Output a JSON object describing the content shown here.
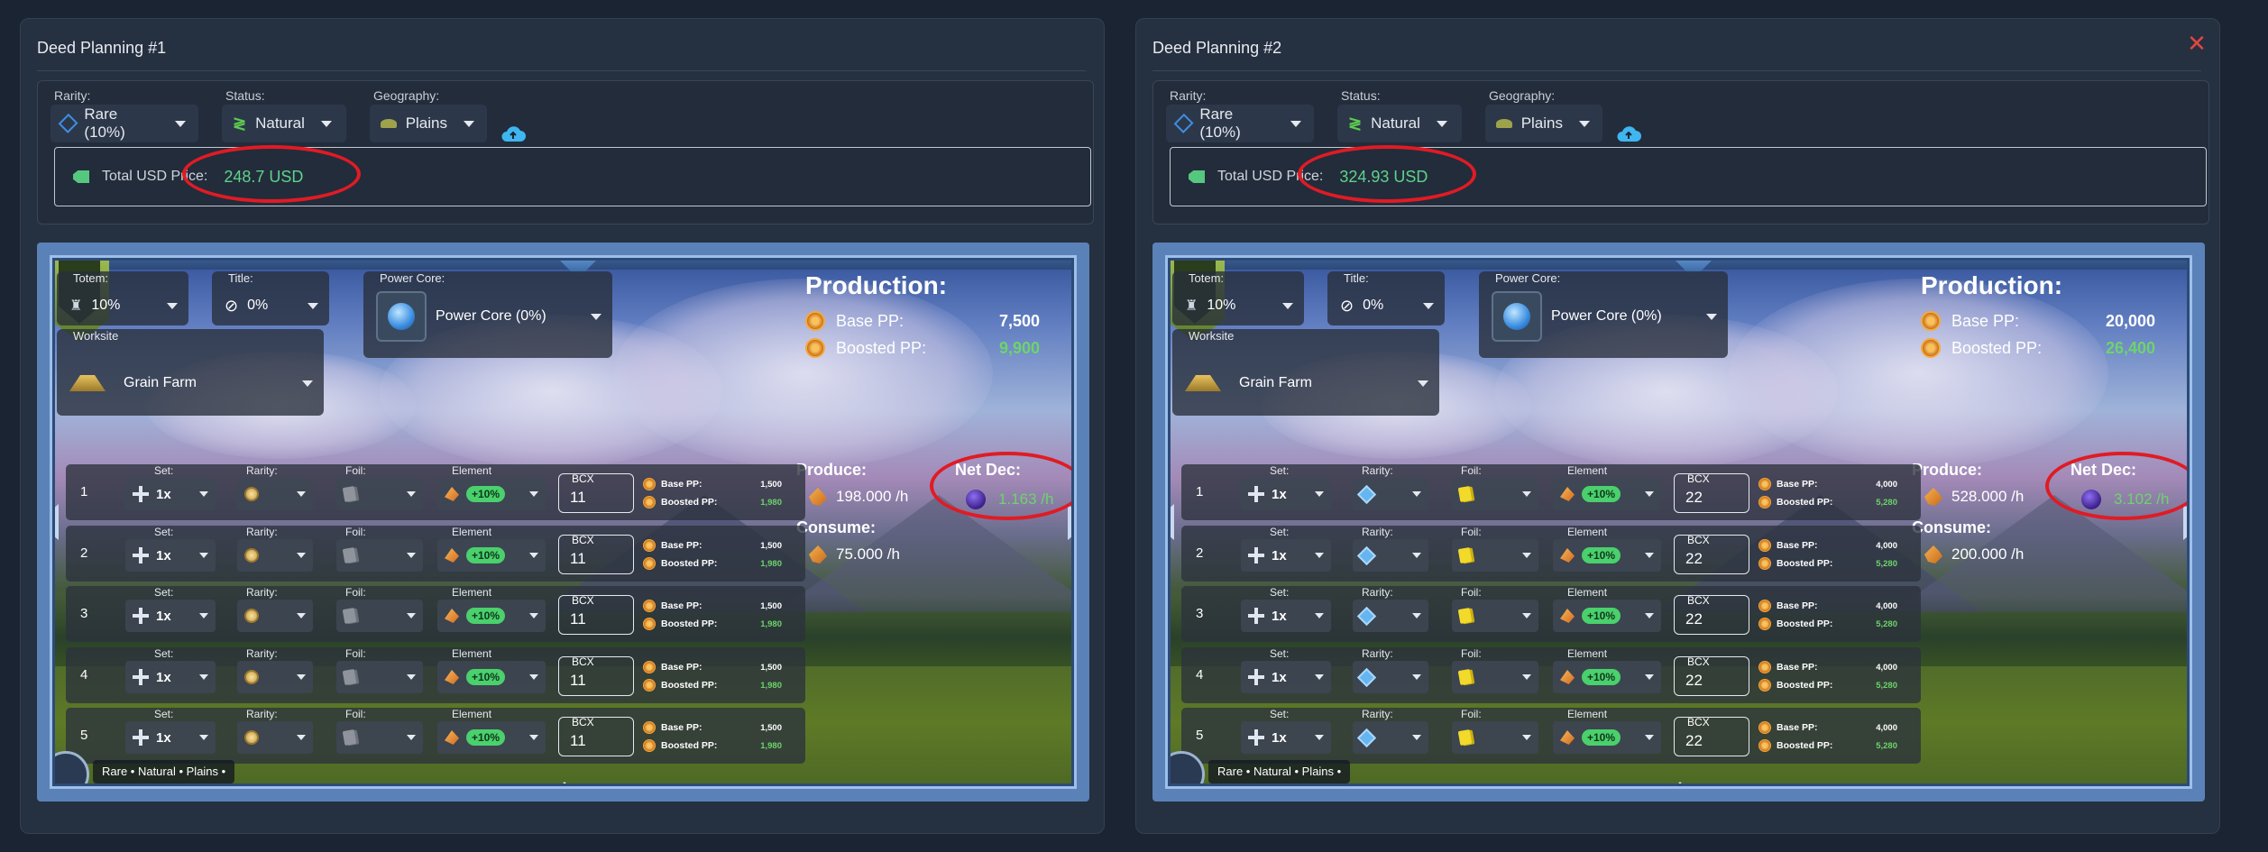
{
  "panels": [
    {
      "title": "Deed Planning #1",
      "rarity": {
        "label": "Rarity:",
        "value": "Rare (10%)"
      },
      "status": {
        "label": "Status:",
        "value": "Natural"
      },
      "geography": {
        "label": "Geography:",
        "value": "Plains"
      },
      "price_label": "Total USD Price:",
      "price_value": "248.7 USD",
      "totem": {
        "label": "Totem:",
        "value": "10%"
      },
      "title_ctl": {
        "label": "Title:",
        "value": "0%"
      },
      "power_core": {
        "label": "Power Core:",
        "value": "Power Core (0%)"
      },
      "worksite": {
        "label": "Worksite",
        "value": "Grain Farm"
      },
      "production": {
        "title": "Production:",
        "base_label": "Base PP:",
        "base_value": "7,500",
        "boosted_label": "Boosted PP:",
        "boosted_value": "9,900"
      },
      "produce": {
        "title": "Produce:",
        "value": "198.000 /h"
      },
      "consume": {
        "title": "Consume:",
        "value": "75.000 /h"
      },
      "net_dec": {
        "title": "Net Dec:",
        "value": "1.163 /h"
      },
      "footer": "Rare • Natural • Plains •",
      "cards": [
        {
          "num": "1",
          "set": "1x",
          "rarity_icon": "gold-rarity-icon",
          "foil_icon": "grey-foil-icon",
          "bonus": "+10%",
          "bcx": "11",
          "base_pp": "1,500",
          "boosted_pp": "1,980"
        },
        {
          "num": "2",
          "set": "1x",
          "rarity_icon": "gold-rarity-icon",
          "foil_icon": "grey-foil-icon",
          "bonus": "+10%",
          "bcx": "11",
          "base_pp": "1,500",
          "boosted_pp": "1,980"
        },
        {
          "num": "3",
          "set": "1x",
          "rarity_icon": "gold-rarity-icon",
          "foil_icon": "grey-foil-icon",
          "bonus": "+10%",
          "bcx": "11",
          "base_pp": "1,500",
          "boosted_pp": "1,980"
        },
        {
          "num": "4",
          "set": "1x",
          "rarity_icon": "gold-rarity-icon",
          "foil_icon": "grey-foil-icon",
          "bonus": "+10%",
          "bcx": "11",
          "base_pp": "1,500",
          "boosted_pp": "1,980"
        },
        {
          "num": "5",
          "set": "1x",
          "rarity_icon": "gold-rarity-icon",
          "foil_icon": "grey-foil-icon",
          "bonus": "+10%",
          "bcx": "11",
          "base_pp": "1,500",
          "boosted_pp": "1,980"
        }
      ]
    },
    {
      "title": "Deed Planning #2",
      "rarity": {
        "label": "Rarity:",
        "value": "Rare (10%)"
      },
      "status": {
        "label": "Status:",
        "value": "Natural"
      },
      "geography": {
        "label": "Geography:",
        "value": "Plains"
      },
      "price_label": "Total USD Price:",
      "price_value": "324.93 USD",
      "totem": {
        "label": "Totem:",
        "value": "10%"
      },
      "title_ctl": {
        "label": "Title:",
        "value": "0%"
      },
      "power_core": {
        "label": "Power Core:",
        "value": "Power Core (0%)"
      },
      "worksite": {
        "label": "Worksite",
        "value": "Grain Farm"
      },
      "production": {
        "title": "Production:",
        "base_label": "Base PP:",
        "base_value": "20,000",
        "boosted_label": "Boosted PP:",
        "boosted_value": "26,400"
      },
      "produce": {
        "title": "Produce:",
        "value": "528.000 /h"
      },
      "consume": {
        "title": "Consume:",
        "value": "200.000 /h"
      },
      "net_dec": {
        "title": "Net Dec:",
        "value": "3.102 /h"
      },
      "footer": "Rare • Natural • Plains •",
      "cards": [
        {
          "num": "1",
          "set": "1x",
          "rarity_icon": "blue-rarity-icon",
          "foil_icon": "gold-foil-icon",
          "bonus": "+10%",
          "bcx": "22",
          "base_pp": "4,000",
          "boosted_pp": "5,280"
        },
        {
          "num": "2",
          "set": "1x",
          "rarity_icon": "blue-rarity-icon",
          "foil_icon": "gold-foil-icon",
          "bonus": "+10%",
          "bcx": "22",
          "base_pp": "4,000",
          "boosted_pp": "5,280"
        },
        {
          "num": "3",
          "set": "1x",
          "rarity_icon": "blue-rarity-icon",
          "foil_icon": "gold-foil-icon",
          "bonus": "+10%",
          "bcx": "22",
          "base_pp": "4,000",
          "boosted_pp": "5,280"
        },
        {
          "num": "4",
          "set": "1x",
          "rarity_icon": "blue-rarity-icon",
          "foil_icon": "gold-foil-icon",
          "bonus": "+10%",
          "bcx": "22",
          "base_pp": "4,000",
          "boosted_pp": "5,280"
        },
        {
          "num": "5",
          "set": "1x",
          "rarity_icon": "blue-rarity-icon",
          "foil_icon": "gold-foil-icon",
          "bonus": "+10%",
          "bcx": "22",
          "base_pp": "4,000",
          "boosted_pp": "5,280"
        }
      ]
    }
  ],
  "labels": {
    "set": "Set:",
    "rarity": "Rarity:",
    "foil": "Foil:",
    "element": "Element",
    "bcx": "BCX",
    "base_pp": "Base PP:",
    "boosted_pp": "Boosted PP:"
  },
  "colors": {
    "price_green": "#5fd28a",
    "boosted_green": "#6ed36c",
    "close_red": "#e0473f",
    "annotation_red": "#e01b24"
  }
}
